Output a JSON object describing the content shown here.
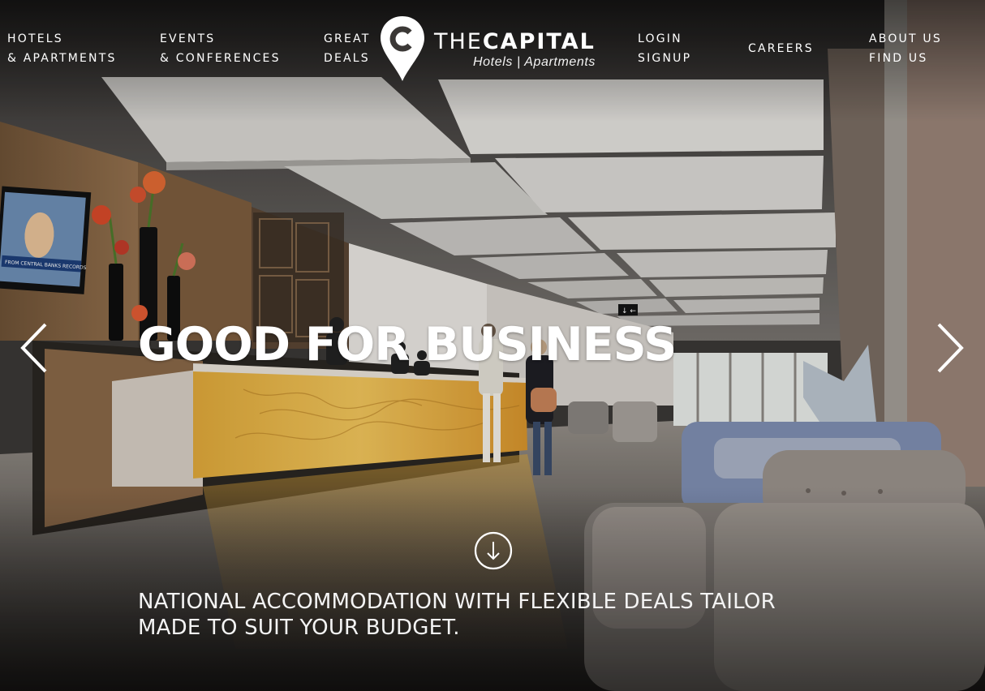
{
  "nav": {
    "hotels": {
      "line1": "HOTELS",
      "line2": "& APARTMENTS"
    },
    "events": {
      "line1": "EVENTS",
      "line2": "& CONFERENCES"
    },
    "deals": {
      "line1": "GREAT",
      "line2": "DEALS"
    },
    "account": {
      "line1": "LOGIN",
      "line2": "SIGNUP"
    },
    "careers": {
      "line1": "CAREERS"
    },
    "about": {
      "line1": "ABOUT US",
      "line2": "FIND US"
    }
  },
  "logo": {
    "mark": "C",
    "word_thin": "THE",
    "word_bold": "CAPITAL",
    "tagline": "Hotels | Apartments"
  },
  "hero": {
    "headline": "GOOD FOR BUSINESS",
    "tagline_line1": "NATIONAL ACCOMMODATION WITH FLEXIBLE DEALS TAILOR",
    "tagline_line2": "MADE TO SUIT YOUR BUDGET.",
    "tv_banner": "FROM CENTRAL BANKS RECORDS",
    "exit_sign": "↓ ←"
  },
  "icons": {
    "prev": "chevron-left-icon",
    "next": "chevron-right-icon",
    "scroll": "arrow-down-circle-icon"
  },
  "colors": {
    "text": "#ffffff",
    "counter_glow": "#e8a830"
  }
}
